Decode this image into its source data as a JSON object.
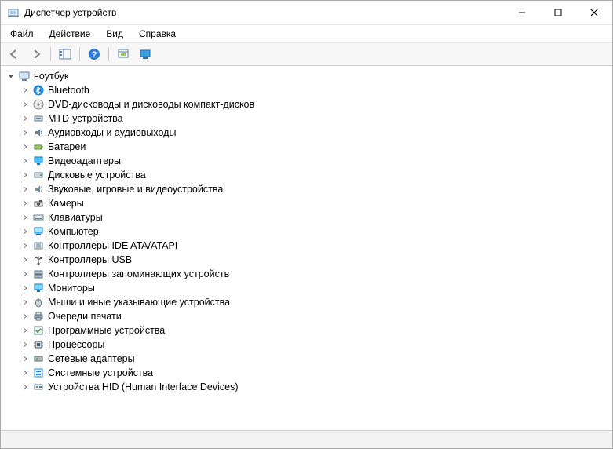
{
  "window": {
    "title": "Диспетчер устройств"
  },
  "menu": {
    "file": "Файл",
    "action": "Действие",
    "view": "Вид",
    "help": "Справка"
  },
  "tree": {
    "root": {
      "label": "ноутбук",
      "expanded": true
    },
    "items": [
      {
        "label": "Bluetooth",
        "icon": "bluetooth"
      },
      {
        "label": "DVD-дисководы и дисководы компакт-дисков",
        "icon": "optical"
      },
      {
        "label": "MTD-устройства",
        "icon": "mtd"
      },
      {
        "label": "Аудиовходы и аудиовыходы",
        "icon": "audio"
      },
      {
        "label": "Батареи",
        "icon": "battery"
      },
      {
        "label": "Видеоадаптеры",
        "icon": "display"
      },
      {
        "label": "Дисковые устройства",
        "icon": "disk"
      },
      {
        "label": "Звуковые, игровые и видеоустройства",
        "icon": "sound"
      },
      {
        "label": "Камеры",
        "icon": "camera"
      },
      {
        "label": "Клавиатуры",
        "icon": "keyboard"
      },
      {
        "label": "Компьютер",
        "icon": "computer"
      },
      {
        "label": "Контроллеры IDE ATA/ATAPI",
        "icon": "ide"
      },
      {
        "label": "Контроллеры USB",
        "icon": "usb"
      },
      {
        "label": "Контроллеры запоминающих устройств",
        "icon": "storagectl"
      },
      {
        "label": "Мониторы",
        "icon": "monitor"
      },
      {
        "label": "Мыши и иные указывающие устройства",
        "icon": "mouse"
      },
      {
        "label": "Очереди печати",
        "icon": "printer"
      },
      {
        "label": "Программные устройства",
        "icon": "software"
      },
      {
        "label": "Процессоры",
        "icon": "cpu"
      },
      {
        "label": "Сетевые адаптеры",
        "icon": "network"
      },
      {
        "label": "Системные устройства",
        "icon": "system"
      },
      {
        "label": "Устройства HID (Human Interface Devices)",
        "icon": "hid"
      }
    ]
  }
}
